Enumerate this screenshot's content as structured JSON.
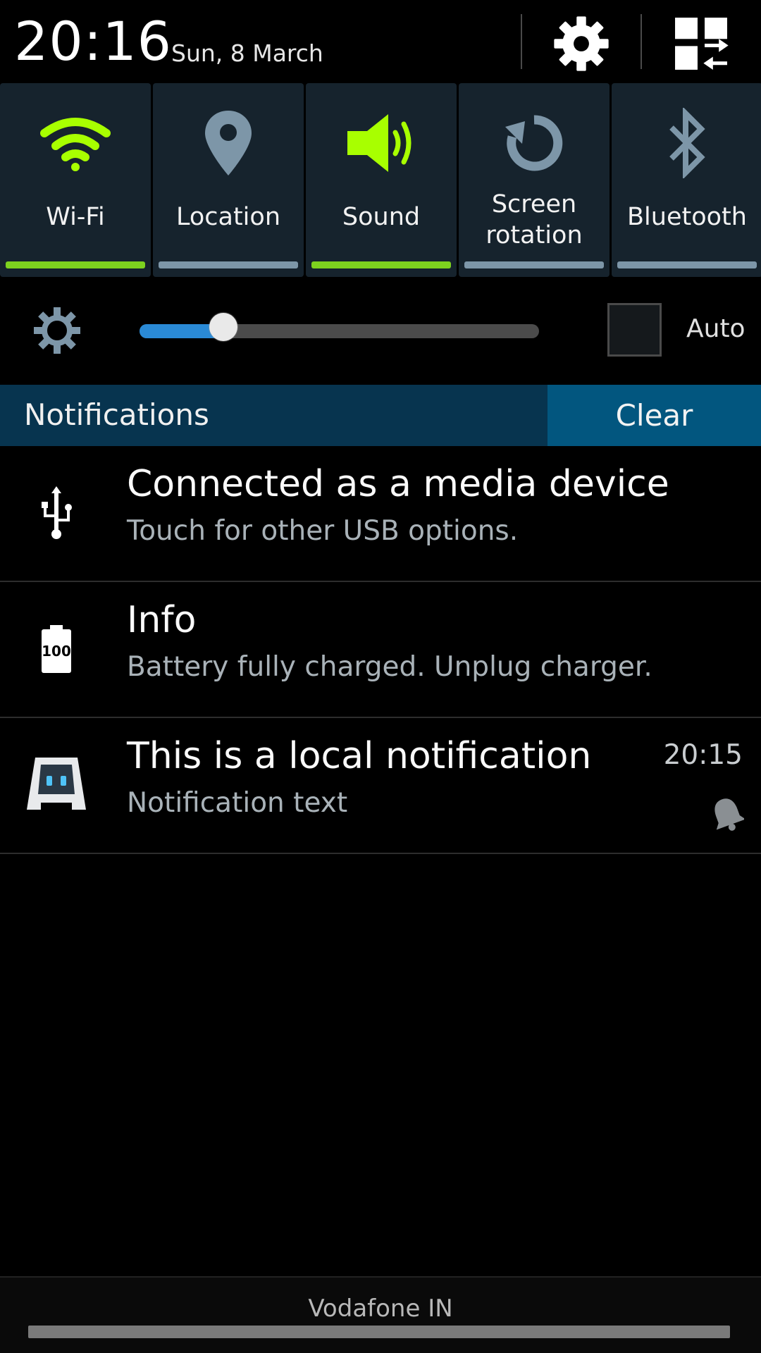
{
  "status": {
    "time": "20:16",
    "date": "Sun, 8 March"
  },
  "header": {
    "settings_icon": "gear-icon",
    "edit_icon": "grid-swap-icon"
  },
  "quick_settings": [
    {
      "label": "Wi-Fi",
      "icon": "wifi-icon",
      "on": true
    },
    {
      "label": "Location",
      "icon": "location-pin-icon",
      "on": false
    },
    {
      "label": "Sound",
      "icon": "speaker-icon",
      "on": true
    },
    {
      "label": "Screen rotation",
      "icon": "rotate-icon",
      "on": false
    },
    {
      "label": "Bluetooth",
      "icon": "bluetooth-icon",
      "on": false
    }
  ],
  "brightness": {
    "level": 0.21,
    "auto_label": "Auto",
    "auto_checked": false
  },
  "notifications": {
    "title": "Notifications",
    "clear_label": "Clear",
    "items": [
      {
        "title": "Connected as a media device",
        "text": "Touch for other USB options.",
        "icon": "usb-icon",
        "time": ""
      },
      {
        "title": "Info",
        "text": "Battery fully charged. Unplug charger.",
        "icon": "battery-icon",
        "battery_value": "100",
        "time": ""
      },
      {
        "title": "This is a local notification",
        "text": "Notification text",
        "icon": "cordova-robot-icon",
        "time": "20:15"
      }
    ]
  },
  "footer": {
    "carrier": "Vodafone IN"
  },
  "colors": {
    "accent_on": "#7dd21f",
    "slider_fill": "#2a8ad6",
    "notif_bar": "#07344f",
    "clear_button": "#02567f"
  }
}
